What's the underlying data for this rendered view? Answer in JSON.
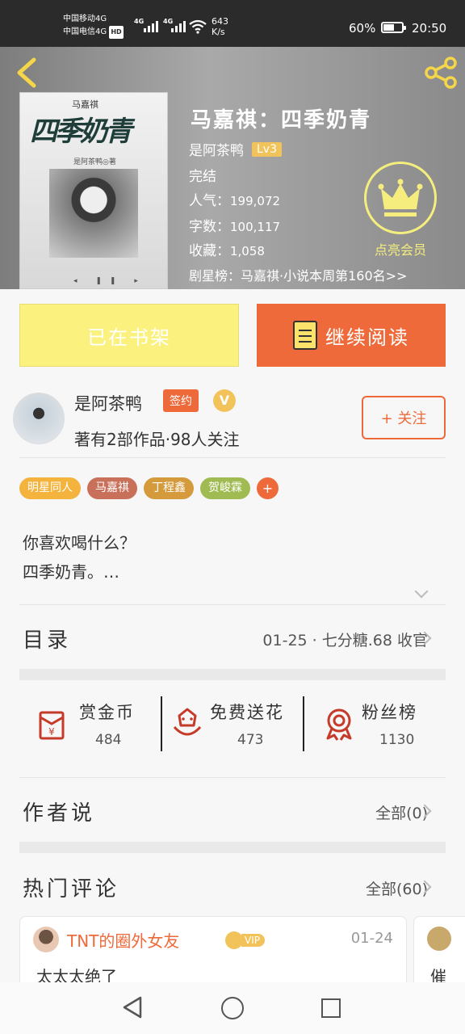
{
  "status_bar": {
    "carrier1": "中国移动4G",
    "carrier2": "中国电信4G",
    "hd": "HD",
    "net1": "4G",
    "net2": "4G",
    "speed_value": "643",
    "speed_unit": "K/s",
    "battery_pct": "60%",
    "battery_level": 0.6,
    "time": "20:50"
  },
  "book": {
    "cover_author": "马嘉祺",
    "cover_title": "四季奶青",
    "cover_sub": "是阿茶鸭◎著",
    "title": "马嘉祺：四季奶青",
    "author": "是阿茶鸭",
    "level": "Lv3",
    "status": "完结",
    "popularity_label": "人气：",
    "popularity": "199,072",
    "words_label": "字数：",
    "words": "100,117",
    "favorites_label": "收藏：",
    "favorites": "1,058",
    "rank": "剧星榜：马嘉祺·小说本周第160名>>",
    "member_label": "点亮会员"
  },
  "actions": {
    "shelf": "已在书架",
    "read": "继续阅读"
  },
  "author_info": {
    "name": "是阿茶鸭",
    "signed": "签约",
    "v": "V",
    "stats": "著有2部作品·98人关注",
    "follow": "+ 关注"
  },
  "tags": [
    {
      "label": "明星同人",
      "color": "#f3b33d"
    },
    {
      "label": "马嘉祺",
      "color": "#c9705a"
    },
    {
      "label": "丁程鑫",
      "color": "#d49a3c"
    },
    {
      "label": "贺峻霖",
      "color": "#9fbb52"
    },
    {
      "label": "+",
      "color": "#ee6a3a"
    }
  ],
  "intro": "你喜欢喝什么？\n四季奶青。…",
  "catalog": {
    "title": "目录",
    "latest": "01-25 · 七分糖.68 收官"
  },
  "stats": [
    {
      "label": "赏金币",
      "value": "484",
      "icon": "red-envelope-icon"
    },
    {
      "label": "免费送花",
      "value": "473",
      "icon": "flower-icon"
    },
    {
      "label": "粉丝榜",
      "value": "1130",
      "icon": "medal-icon"
    }
  ],
  "author_says": {
    "title": "作者说",
    "all": "全部(0)"
  },
  "hot_comments": {
    "title": "热门评论",
    "all": "全部(60)",
    "items": [
      {
        "user": "TNT的圈外女友",
        "vip": "VIP",
        "date": "01-24",
        "text": "太太太绝了"
      },
      {
        "user": "",
        "vip": "",
        "date": "",
        "text": "催"
      }
    ]
  }
}
